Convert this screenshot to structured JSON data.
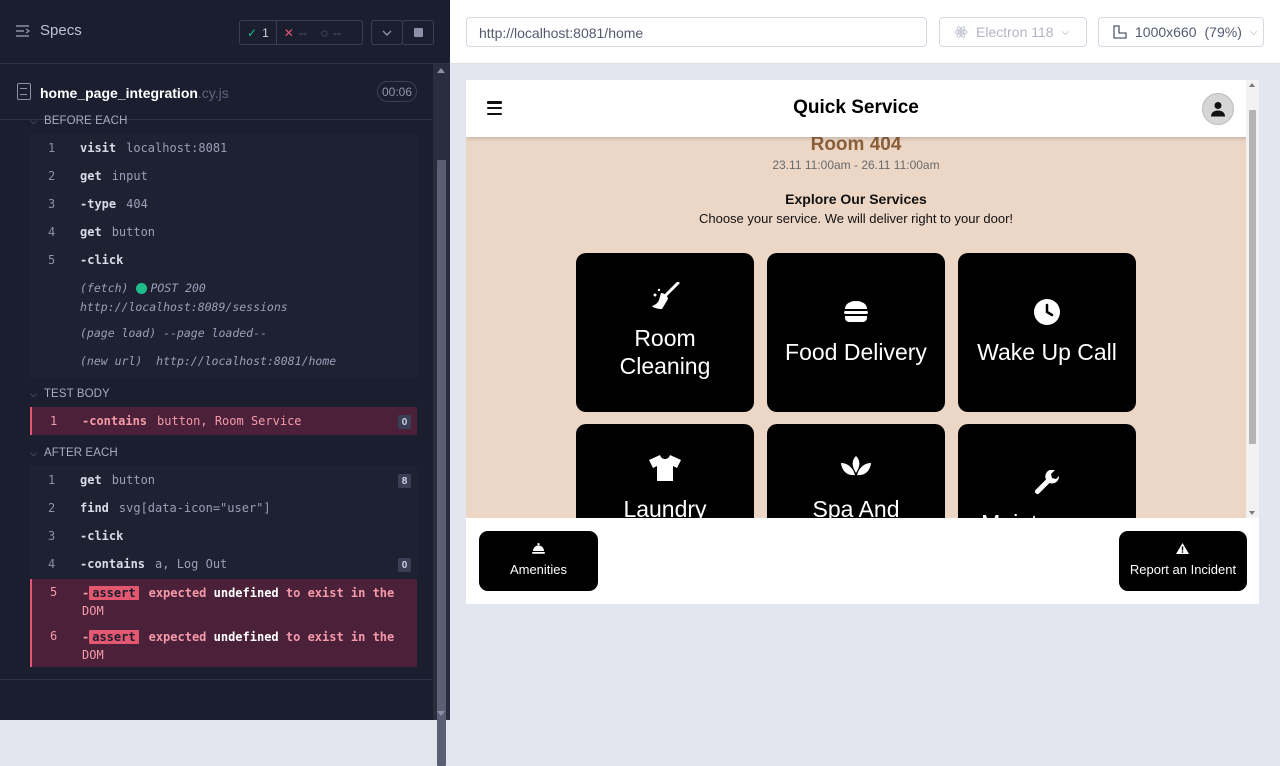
{
  "runner": {
    "specs_label": "Specs",
    "stats": {
      "passed": "1",
      "failed": "--",
      "pending": "--"
    },
    "file": {
      "name": "home_page_integration",
      "ext": ".cy.js",
      "duration": "00:06"
    },
    "before_each": {
      "label": "BEFORE EACH",
      "commands": [
        {
          "num": "1",
          "name": "visit",
          "arg": "localhost:8081"
        },
        {
          "num": "2",
          "name": "get",
          "arg": "input"
        },
        {
          "num": "3",
          "name": "-type",
          "arg": "404"
        },
        {
          "num": "4",
          "name": "get",
          "arg": "button"
        },
        {
          "num": "5",
          "name": "-click",
          "arg": ""
        }
      ],
      "fetch_label": "(fetch)",
      "fetch_status": "POST 200",
      "fetch_url": "http://localhost:8089/sessions",
      "page_load": "(page load)  --page loaded--",
      "new_url_label": "(new url)",
      "new_url": "http://localhost:8081/home"
    },
    "test_body": {
      "label": "TEST BODY",
      "command": {
        "num": "1",
        "name": "-contains",
        "arg": "button, Room Service",
        "badge": "0"
      }
    },
    "after_each": {
      "label": "AFTER EACH",
      "commands": [
        {
          "num": "1",
          "name": "get",
          "arg": "button",
          "badge": "8"
        },
        {
          "num": "2",
          "name": "find",
          "arg": "svg[data-icon=\"user\"]"
        },
        {
          "num": "3",
          "name": "-click",
          "arg": ""
        },
        {
          "num": "4",
          "name": "-contains",
          "arg": "a, Log Out",
          "badge": "0"
        }
      ],
      "asserts": [
        {
          "num": "5",
          "name": "-",
          "tag": "assert",
          "w1": "expected",
          "w2": "undefined",
          "w3": "to exist in the",
          "w4": "DOM"
        },
        {
          "num": "6",
          "name": "-",
          "tag": "assert",
          "w1": "expected",
          "w2": "undefined",
          "w3": "to exist in the",
          "w4": "DOM"
        }
      ]
    }
  },
  "browser": {
    "url": "http://localhost:8081/home",
    "engine": "Electron 118",
    "viewport": "1000x660",
    "zoom": "(79%)"
  },
  "app": {
    "title": "Quick Service",
    "room": "Room 404",
    "dates": "23.11 11:00am - 26.11 11:00am",
    "explore": "Explore Our Services",
    "choose": "Choose your service. We will deliver right to your door!",
    "services": [
      {
        "line1": "Room",
        "line2": "Cleaning",
        "icon": "broom-icon"
      },
      {
        "line1": "Food Delivery",
        "icon": "burger-icon"
      },
      {
        "line1": "Wake Up Call",
        "icon": "clock-icon"
      },
      {
        "line1": "Laundry",
        "icon": "shirt-icon"
      },
      {
        "line1": "Spa And",
        "icon": "spa-icon"
      },
      {
        "line1": "Maintenance",
        "icon": "wrench-icon"
      }
    ],
    "amenities": "Amenities",
    "report": "Report an Incident"
  },
  "colors": {
    "runner_bg": "#1b1e2e",
    "pass": "#1fbd8c",
    "fail": "#e45770",
    "app_bg": "#ecd7c7",
    "room_text": "#8a5f3a"
  }
}
